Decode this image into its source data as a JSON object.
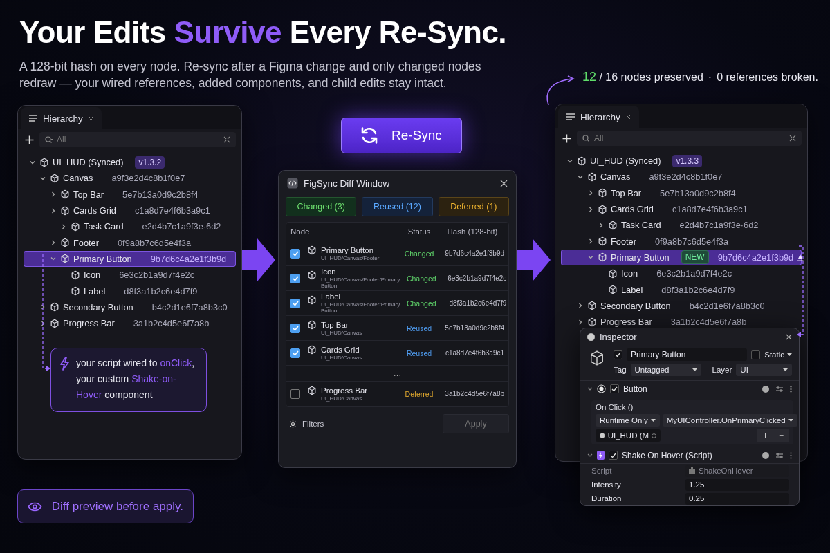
{
  "headline": {
    "segments": [
      {
        "text": "Your Edits ",
        "accent": false
      },
      {
        "text": "Survive",
        "accent": true
      },
      {
        "text": " Every Re-Sync.",
        "accent": false
      }
    ]
  },
  "subtitle": "A 128-bit hash on every node. Re-sync after a Figma change and only changed nodes redraw — your wired references, added components, and child edits stay intact.",
  "stats": {
    "preserved": "12",
    "total": "/ 16 nodes preserved",
    "separator": "·",
    "broken": "0 references broken."
  },
  "hierarchy_before": {
    "tab": "Hierarchy",
    "search": {
      "placeholder": "All"
    },
    "tree": [
      {
        "name": "UI_HUD (Synced)",
        "expanded": true,
        "selected": false,
        "badge": {
          "text": "v1.3.2",
          "kind": "version"
        },
        "children": [
          {
            "name": "Canvas",
            "hash": "a9f3e2d4c8b1f0e7",
            "expanded": true,
            "selected": false,
            "children": [
              {
                "name": "Top Bar",
                "hash": "5e7b13a0d9c2b8f4",
                "expanded": false,
                "selected": false
              },
              {
                "name": "Cards Grid",
                "hash": "c1a8d7e4f6b3a9c1",
                "expanded": false,
                "selected": false,
                "children": [
                  {
                    "name": "Task Card",
                    "hash": "e2d4b7c1a9f3e·6d2",
                    "expanded": false,
                    "selected": false
                  }
                ]
              },
              {
                "name": "Footer",
                "hash": "0f9a8b7c6d5e4f3a",
                "expanded": false,
                "selected": false
              },
              {
                "name": "Primary Button",
                "hash": "9b7d6c4a2e1f3b9d",
                "expanded": true,
                "selected": true,
                "children": [
                  {
                    "name": "Icon",
                    "hash": "6e3c2b1a9d7f4e2c",
                    "selected": false
                  },
                  {
                    "name": "Label",
                    "hash": "d8f3a1b2c6e4d7f9",
                    "selected": false
                  }
                ]
              }
            ]
          },
          {
            "name": "Secondary Button",
            "hash": "b4c2d1e6f7a8b3c0",
            "expanded": false,
            "selected": false
          },
          {
            "name": "Progress Bar",
            "hash": "3a1b2c4d5e6f7a8b",
            "expanded": false,
            "selected": false
          }
        ]
      }
    ]
  },
  "callout": {
    "segments": [
      {
        "text": "your script wired to ",
        "accent": false
      },
      {
        "text": "onClick",
        "accent": true
      },
      {
        "text": ", your custom ",
        "accent": false
      },
      {
        "text": "Shake-on-Hover",
        "accent": true
      },
      {
        "text": " component",
        "accent": false
      }
    ]
  },
  "preview_note": "Diff preview before apply.",
  "resync_button": {
    "label": "Re-Sync"
  },
  "diff_window": {
    "title": "FigSync Diff Window",
    "filters": [
      {
        "label": "Changed (3)",
        "kind": "changed"
      },
      {
        "label": "Reused (12)",
        "kind": "reused"
      },
      {
        "label": "Deferred (1)",
        "kind": "deferred"
      }
    ],
    "columns": [
      "Node",
      "Status",
      "Hash (128-bit)"
    ],
    "rows": [
      {
        "kind": "node",
        "checked": true,
        "name": "Primary Button",
        "path": "UI_HUD/Canvas/Footer",
        "status": "Changed",
        "color": "#5fd36a",
        "hash": "9b7d6c4a2e1f3b9d"
      },
      {
        "kind": "node",
        "checked": true,
        "name": "Icon",
        "path": "UI_HUD/Canvas/Footer/Primary Button",
        "status": "Changed",
        "color": "#5fd36a",
        "hash": "6e3c2b1a9d7f4e2c"
      },
      {
        "kind": "node",
        "checked": true,
        "name": "Label",
        "path": "UI_HUD/Canvas/Footer/Primary Button",
        "status": "Changed",
        "color": "#5fd36a",
        "hash": "d8f3a1b2c6e4d7f9"
      },
      {
        "kind": "node",
        "checked": true,
        "name": "Top Bar",
        "path": "UI_HUD/Canvas",
        "status": "Reused",
        "color": "#4f9cf0",
        "hash": "5e7b13a0d9c2b8f4"
      },
      {
        "kind": "node",
        "checked": true,
        "name": "Cards Grid",
        "path": "UI_HUD/Canvas",
        "status": "Reused",
        "color": "#4f9cf0",
        "hash": "c1a8d7e4f6b3a9c1"
      },
      {
        "kind": "gap",
        "text": "…"
      },
      {
        "kind": "node",
        "checked": false,
        "name": "Progress Bar",
        "path": "UI_HUD/Canvas",
        "status": "Deferred",
        "color": "#e0a82e",
        "hash": "3a1b2c4d5e6f7a8b"
      }
    ],
    "filters_button": "Filters",
    "apply": {
      "label": "Apply",
      "disabled": true
    }
  },
  "hierarchy_after": {
    "tab": "Hierarchy",
    "search": {
      "placeholder": "All"
    },
    "tree": [
      {
        "name": "UI_HUD (Synced)",
        "expanded": true,
        "selected": false,
        "overridden": false,
        "badge": {
          "text": "v1.3.3",
          "kind": "version"
        },
        "children": [
          {
            "name": "Canvas",
            "hash": "a9f3e2d4c8b1f0e7",
            "expanded": true,
            "selected": false,
            "overridden": false,
            "children": [
              {
                "name": "Top Bar",
                "hash": "5e7b13a0d9c2b8f4",
                "expanded": false,
                "selected": false,
                "overridden": false
              },
              {
                "name": "Cards Grid",
                "hash": "c1a8d7e4f6b3a9c1",
                "expanded": false,
                "selected": false,
                "overridden": false,
                "children": [
                  {
                    "name": "Task Card",
                    "hash": "e2d4b7c1a9f3e·6d2",
                    "expanded": false,
                    "selected": false,
                    "overridden": false
                  }
                ]
              },
              {
                "name": "Footer",
                "hash": "0f9a8b7c6d5e4f3a",
                "expanded": false,
                "selected": false,
                "overridden": false
              },
              {
                "name": "Primary Button",
                "hash": "9b7d6c4a2e1f3b9d",
                "expanded": true,
                "selected": true,
                "overridden": true,
                "badge": {
                  "text": "NEW",
                  "kind": "new"
                },
                "children": [
                  {
                    "name": "Icon",
                    "hash": "6e3c2b1a9d7f4e2c",
                    "selected": false,
                    "overridden": false
                  },
                  {
                    "name": "Label",
                    "hash": "d8f3a1b2c6e4d7f9",
                    "selected": false,
                    "overridden": false
                  }
                ]
              }
            ]
          },
          {
            "name": "Secondary Button",
            "hash": "b4c2d1e6f7a8b3c0",
            "expanded": false,
            "selected": false,
            "overridden": false
          },
          {
            "name": "Progress Bar",
            "hash": "3a1b2c4d5e6f7a8b",
            "expanded": false,
            "selected": false,
            "overridden": false
          }
        ]
      }
    ]
  },
  "inspector": {
    "title": "Inspector",
    "active": true,
    "name": "Primary Button",
    "static": {
      "label": "Static",
      "checked": false
    },
    "tag": {
      "label": "Tag",
      "value": "Untagged"
    },
    "layer": {
      "label": "Layer",
      "value": "UI"
    },
    "components": [
      {
        "kind": "button",
        "name": "Button",
        "enabled": true,
        "event": "On Click ()",
        "mode": "Runtime Only",
        "function": "MyUIController.OnPrimaryClicked",
        "target": "UI_HUD (M",
        "add": "+",
        "remove": "−"
      },
      {
        "kind": "script",
        "name": "Shake On Hover (Script)",
        "enabled": true,
        "fields": [
          {
            "label": "Script",
            "value": "ShakeOnHover",
            "disabled": true
          },
          {
            "label": "Intensity",
            "value": "1.25",
            "disabled": false
          },
          {
            "label": "Duration",
            "value": "0.25",
            "disabled": false
          }
        ]
      }
    ]
  }
}
